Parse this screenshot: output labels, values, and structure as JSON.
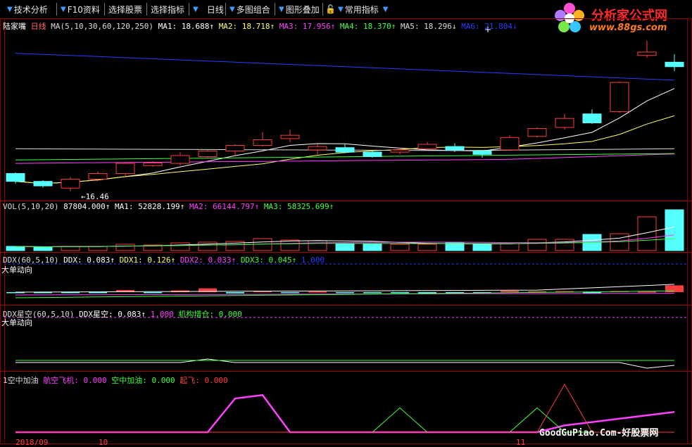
{
  "toolbar": {
    "items": [
      "技术分析",
      "F10资料",
      "选择股票",
      "选择指标",
      "日线",
      "多图组合",
      "图形叠加",
      "常用指标"
    ]
  },
  "logo": {
    "title": "分析家公式网",
    "url": "www.88gs.com"
  },
  "price_panel": {
    "stock": "陆家嘴",
    "period": "日线",
    "ma_params": "MA(5,10,30,60,120,250)",
    "ma1": "MA1: 18.688↑",
    "ma2": "MA2: 18.718↑",
    "ma3": "MA3: 17.956↑",
    "ma4": "MA4: 18.370↑",
    "ma5": "MA5: 18.296↓",
    "ma6": "MA6: 21.804↓",
    "low_mark": "16.46"
  },
  "vol_panel": {
    "title": "VOL(5,10,20)",
    "v": "87804.000↑",
    "ma1": "MA1: 52828.199↑",
    "ma2": "MA2: 66144.797↑",
    "ma3": "MA3: 58325.699↑"
  },
  "ddx_panel": {
    "title": "DDX(60,5,10)",
    "ddx": "DDX: 0.083↑",
    "ddx1": "DDX1: 0.126↑",
    "ddx2": "DDX2: 0.033↑",
    "ddx3": "DDX3: 0.045↑",
    "val": "1.000",
    "sub": "大单动向"
  },
  "star_panel": {
    "title": "DDX星空(60,5,10)",
    "ddx": "DDX星空: 0.083↑",
    "val": "1.000",
    "inst": "机构增仓: 0.000",
    "sub": "大单动向"
  },
  "fuel_panel": {
    "title": "1空中加油",
    "a": "航空飞机: 0.000",
    "b": "空中加油: 0.000",
    "c": "起飞: 0.000"
  },
  "dates": {
    "d1": "2018/09",
    "d2": "10",
    "d3": "11"
  },
  "watermark": "GoodGuPiao.Com-好股票网",
  "colors": {
    "up": "#ff3c3c",
    "down": "#54ffff",
    "magenta": "#ff40ff",
    "green": "#40ff40",
    "yellow": "#ffff40",
    "blue": "#2a3cff",
    "white": "#ffffff"
  },
  "chart_data": {
    "type": "candlestick",
    "candles": [
      {
        "o": 17.25,
        "h": 17.3,
        "l": 16.8,
        "c": 16.9,
        "dir": "down"
      },
      {
        "o": 16.9,
        "h": 16.95,
        "l": 16.62,
        "c": 16.7,
        "dir": "down"
      },
      {
        "o": 16.6,
        "h": 17.1,
        "l": 16.46,
        "c": 17.0,
        "dir": "up"
      },
      {
        "o": 17.0,
        "h": 17.35,
        "l": 16.9,
        "c": 17.25,
        "dir": "up"
      },
      {
        "o": 17.25,
        "h": 17.75,
        "l": 17.15,
        "c": 17.7,
        "dir": "up"
      },
      {
        "o": 17.6,
        "h": 17.8,
        "l": 17.55,
        "c": 17.72,
        "dir": "up"
      },
      {
        "o": 17.7,
        "h": 18.2,
        "l": 17.6,
        "c": 18.05,
        "dir": "up"
      },
      {
        "o": 18.0,
        "h": 18.3,
        "l": 17.9,
        "c": 18.25,
        "dir": "up"
      },
      {
        "o": 18.25,
        "h": 18.55,
        "l": 18.05,
        "c": 18.5,
        "dir": "up"
      },
      {
        "o": 18.5,
        "h": 19.1,
        "l": 18.45,
        "c": 18.75,
        "dir": "up"
      },
      {
        "o": 18.8,
        "h": 19.2,
        "l": 18.65,
        "c": 18.95,
        "dir": "up"
      },
      {
        "o": 18.3,
        "h": 18.55,
        "l": 18.1,
        "c": 18.45,
        "dir": "up"
      },
      {
        "o": 18.4,
        "h": 18.55,
        "l": 18.15,
        "c": 18.2,
        "dir": "down"
      },
      {
        "o": 18.2,
        "h": 18.25,
        "l": 17.95,
        "c": 18.0,
        "dir": "down"
      },
      {
        "o": 18.2,
        "h": 18.4,
        "l": 18.1,
        "c": 18.3,
        "dir": "up"
      },
      {
        "o": 18.35,
        "h": 18.65,
        "l": 18.3,
        "c": 18.55,
        "dir": "up"
      },
      {
        "o": 18.45,
        "h": 18.6,
        "l": 18.2,
        "c": 18.3,
        "dir": "down"
      },
      {
        "o": 18.25,
        "h": 18.3,
        "l": 17.95,
        "c": 18.1,
        "dir": "down"
      },
      {
        "o": 18.3,
        "h": 18.95,
        "l": 18.25,
        "c": 18.85,
        "dir": "up"
      },
      {
        "o": 18.9,
        "h": 19.3,
        "l": 18.85,
        "c": 19.25,
        "dir": "up"
      },
      {
        "o": 19.3,
        "h": 19.9,
        "l": 19.2,
        "c": 19.7,
        "dir": "up"
      },
      {
        "o": 19.9,
        "h": 20.1,
        "l": 19.45,
        "c": 19.5,
        "dir": "down"
      },
      {
        "o": 20.0,
        "h": 21.35,
        "l": 19.95,
        "c": 21.3,
        "dir": "up"
      },
      {
        "o": 22.5,
        "h": 23.15,
        "l": 22.4,
        "c": 22.65,
        "dir": "up"
      },
      {
        "o": 22.2,
        "h": 22.55,
        "l": 21.8,
        "c": 22.0,
        "dir": "down"
      }
    ],
    "volume": [
      6,
      5,
      6,
      6,
      9,
      8,
      11,
      12,
      13,
      17,
      15,
      14,
      10,
      10,
      9,
      9,
      11,
      9,
      10,
      16,
      16,
      23,
      24,
      48,
      58
    ],
    "fuel_magenta": [
      0,
      0,
      0,
      0,
      0,
      0,
      0,
      0,
      30,
      33,
      0,
      0,
      0,
      0,
      0,
      0,
      0,
      0,
      0,
      0,
      6,
      9,
      12,
      15,
      18
    ],
    "fuel_green": [
      0,
      0,
      0,
      0,
      0,
      0,
      0,
      0,
      0,
      0,
      0,
      0,
      0,
      0,
      18,
      0,
      0,
      0,
      0,
      18,
      0,
      0,
      0,
      0,
      0
    ]
  }
}
